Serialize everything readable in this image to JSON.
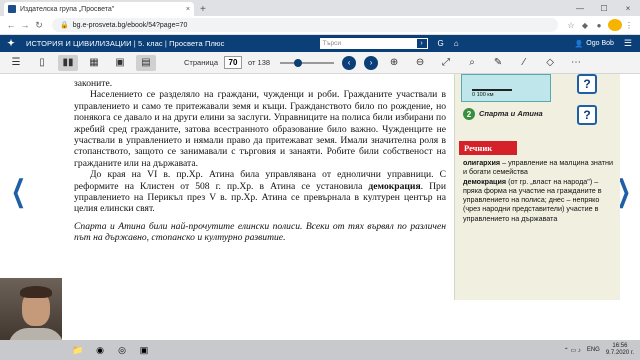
{
  "browser": {
    "tab_title": "Издателска група „Просвета\"",
    "tab_close": "×",
    "new_tab": "+",
    "url": "bg.e-prosveta.bg/ebook/54?page=70",
    "window_controls": [
      "—",
      "☐",
      "×"
    ]
  },
  "app": {
    "title": "ИСТОРИЯ И ЦИВИЛИЗАЦИИ | 5. клас | Просвета Плюс",
    "search_placeholder": "Търси",
    "user": "Ogo Bob"
  },
  "toolbar": {
    "page_label": "Страница",
    "page_value": "70",
    "page_of": "от 138"
  },
  "book": {
    "paragraphs": [
      {
        "indent": false,
        "text": "законите."
      },
      {
        "indent": true,
        "text": "Населението се разделяло на граждани, чужденци и роби. Гражданите участвали в управлението и само те притежавали земя и къщи. Гражданството било по рождение, но понякога се давало и на други елини за заслуги. Управниците на полиса били избирани по жребий сред гражданите, затова всестранното образование било важно. Чужденците не участвали в управлението и нямали право да притежават земя. Имали значителна роля в стопанството, защото се занимавали с търговия и занаяти. Робите били собственост на гражданите или на държавата."
      },
      {
        "indent": true,
        "text_before": "До края на VI в. пр.Хр. Атина била управлявана от еднолични управници. С реформите на Клистен от 508 г. пр.Хр. в Атина се установила ",
        "bold": "демокрация",
        "text_after": ". При управлението на Перикъл през V в. пр.Хр. Атина се превърнала в културен център на целия елински свят."
      }
    ],
    "italic_note": "Спарта и Атина били най-прочутите елински полиси. Всеки от тях вървял по различен път на държавно, стопанско и културно развитие."
  },
  "aside": {
    "scale_label": "0      100 км",
    "number": "2",
    "subtitle": "Спарта и Атина",
    "question_mark": "?",
    "vocab_title": "Речник",
    "vocab_entries": [
      {
        "term": "олигархия",
        "def": " – управление на малцина знатни и богати семейства"
      },
      {
        "term": "демокрация",
        "def": " (от гр. „власт на народа\") – пряка форма на участие на гражданите в управлението на полиса; днес – непряко (чрез народни представители) участие в управлението на държавата"
      }
    ]
  },
  "taskbar": {
    "lang": "ENG",
    "time": "16:56",
    "date": "9.7.2020 г."
  },
  "icons": [
    "tab-favicon",
    "lock-icon",
    "back-icon",
    "forward-icon",
    "reload-icon",
    "logo-icon",
    "search-go-icon",
    "home-icon",
    "user-icon",
    "menu-icon",
    "page-icon",
    "zoom-in-icon",
    "zoom-out-icon",
    "pen-icon",
    "eraser-icon",
    "left-arrow-icon",
    "right-arrow-icon"
  ]
}
